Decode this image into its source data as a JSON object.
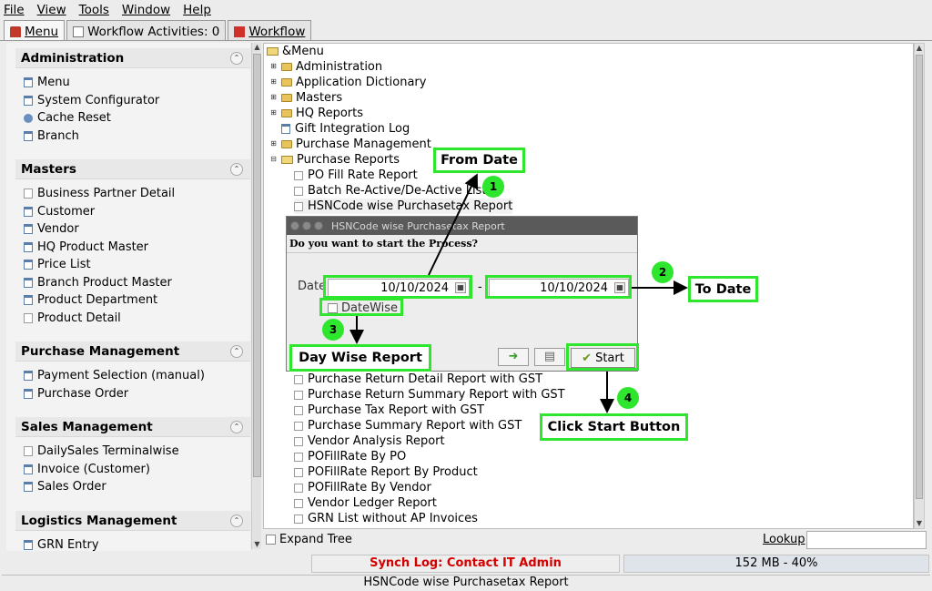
{
  "menubar": {
    "items": [
      "File",
      "View",
      "Tools",
      "Window",
      "Help"
    ]
  },
  "tabs": [
    {
      "label": "Menu",
      "active": true
    },
    {
      "label": "Workflow Activities: 0",
      "active": false
    },
    {
      "label": "Workflow",
      "active": false
    }
  ],
  "sidebar": {
    "groups": [
      {
        "title": "Administration",
        "items": [
          "Menu",
          "System Configurator",
          "Cache Reset",
          "Branch"
        ]
      },
      {
        "title": "Masters",
        "items": [
          "Business Partner Detail",
          "Customer",
          "Vendor",
          "HQ Product Master",
          "Price List",
          "Branch Product Master",
          "Product Department",
          "Product Detail"
        ]
      },
      {
        "title": "Purchase Management",
        "items": [
          "Payment Selection (manual)",
          "Purchase Order"
        ]
      },
      {
        "title": "Sales Management",
        "items": [
          "DailySales Terminalwise",
          "Invoice (Customer)",
          "Sales Order"
        ]
      },
      {
        "title": "Logistics Management",
        "items": [
          "GRN Entry"
        ]
      }
    ]
  },
  "tree": {
    "root": "&Menu",
    "nodes": [
      {
        "label": "Administration",
        "kind": "folder"
      },
      {
        "label": "Application Dictionary",
        "kind": "folder"
      },
      {
        "label": "Masters",
        "kind": "folder"
      },
      {
        "label": "HQ Reports",
        "kind": "folder"
      },
      {
        "label": "Gift Integration Log",
        "kind": "window"
      },
      {
        "label": "Purchase Management",
        "kind": "folder"
      },
      {
        "label": "Purchase Reports",
        "kind": "open-folder"
      },
      {
        "label": "PO Fill Rate Report",
        "kind": "report"
      },
      {
        "label": "Batch Re-Active/De-Active List",
        "kind": "report"
      },
      {
        "label": "HSNCode wise Purchasetax Report",
        "kind": "report"
      },
      {
        "label": "Purchase Return Detail Report with GST",
        "kind": "report"
      },
      {
        "label": "Purchase Return Summary Report with GST",
        "kind": "report"
      },
      {
        "label": "Purchase Tax Report with GST",
        "kind": "report"
      },
      {
        "label": "Purchase Summary Report with GST",
        "kind": "report"
      },
      {
        "label": "Vendor Analysis Report",
        "kind": "report"
      },
      {
        "label": "POFillRate By PO",
        "kind": "report"
      },
      {
        "label": "POFillRate Report By Product",
        "kind": "report"
      },
      {
        "label": "POFillRate By Vendor",
        "kind": "report"
      },
      {
        "label": "Vendor Ledger Report",
        "kind": "report"
      },
      {
        "label": "GRN List without AP Invoices",
        "kind": "report"
      }
    ],
    "expand_tree": "Expand Tree",
    "lookup": "Lookup"
  },
  "dialog": {
    "title": "HSNCode wise Purchasetax Report",
    "question": "Do you want to start the Process?",
    "date_label": "Date",
    "date_from": "10/10/2024",
    "date_to": "10/10/2024",
    "dash": "-",
    "datewise_label": "DateWise",
    "start_label": "Start"
  },
  "annotations": {
    "from_date": "From Date",
    "to_date": "To Date",
    "day_wise": "Day Wise Report",
    "click_start": "Click Start Button",
    "steps": [
      "1",
      "2",
      "3",
      "4"
    ],
    "accent_color": "#2ee62e"
  },
  "status": {
    "sync": "Synch Log: Contact IT Admin",
    "memory": "152 MB - 40%",
    "bottom": "HSNCode wise Purchasetax Report"
  }
}
